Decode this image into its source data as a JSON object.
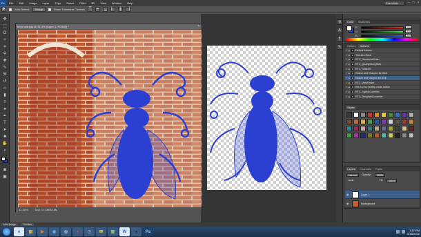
{
  "app": {
    "logo": "Ps",
    "menus": [
      "File",
      "Edit",
      "Image",
      "Layer",
      "Type",
      "Select",
      "Filter",
      "3D",
      "View",
      "Window",
      "Help"
    ],
    "workspace": "Essentials"
  },
  "options": {
    "auto_select_label": "Auto-Select:",
    "auto_select_value": "Group",
    "transform_label": "Show Transform Controls"
  },
  "documents": {
    "doc1": {
      "title": "brick wall.jpg @ 31.3% (Layer 1, RGB/8) *",
      "zoom": "31.33%",
      "doc_size": "Doc: 17.4M/34.8M"
    }
  },
  "panels": {
    "color": {
      "tabs": [
        "Color",
        "Swatches"
      ],
      "rows": [
        {
          "label": "R",
          "value": "255",
          "color": "#ff2a2a"
        },
        {
          "label": "G",
          "value": "255",
          "color": "#2aff2a"
        },
        {
          "label": "B",
          "value": "255",
          "color": "#2a6bff"
        }
      ]
    },
    "actions": {
      "tabs": [
        "History",
        "Actions"
      ],
      "items": [
        {
          "label": "Default Actions",
          "sel": false
        },
        {
          "label": "Textures Rock",
          "sel": false
        },
        {
          "label": "RTC_GoodnessGrain",
          "sel": false
        },
        {
          "label": "RTC_QualityGlow(Web",
          "sel": false
        },
        {
          "label": "RTC_Glitter01",
          "sel": false
        },
        {
          "label": "Resize and Sharpen for Web",
          "sel": false
        },
        {
          "label": "Resize and sharpen for web",
          "sel": true
        },
        {
          "label": "RTC_ViewFinder",
          "sel": false
        },
        {
          "label": "RB in One Quality Clean Action",
          "sel": false
        },
        {
          "label": "RTC_Stylin&ColorSet",
          "sel": false
        },
        {
          "label": "RTC_TemplateConverter",
          "sel": false
        },
        {
          "label": "Textures Rock",
          "sel": false
        },
        {
          "label": "Copyright (c) 2010 - Paint the Moon",
          "sel": false
        }
      ]
    },
    "styles": {
      "tabs": [
        "Styles"
      ],
      "swatches": [
        "#3a3a3a",
        "#ffffff",
        "#888888",
        "#cc3333",
        "#d98a2b",
        "#e6c84a",
        "#4a8a3a",
        "#3a6fc4",
        "#6a3aa4",
        "#b0b0b0",
        "#7a4a2a",
        "#c46a3a",
        "#d4b04a",
        "#4a9a4a",
        "#2a5aa4",
        "#8a3ab4",
        "#d4d4d4",
        "#5a5a5a",
        "#a43a3a",
        "#c48a3a",
        "#2a8aa4",
        "#9a2a5a",
        "#caa",
        "#3a7a7a",
        "#ba8",
        "#6a6a9a",
        "#a4a43a",
        "#444444",
        "#e0c090",
        "#5a2a2a",
        "#3aa43a",
        "#a43aa4",
        "#2a2a7a",
        "#7a7a2a",
        "#b45a2a",
        "#5ab4b4",
        "#cccc66",
        "#222222",
        "#8a8a8a",
        "#c0c0c0"
      ]
    },
    "layers": {
      "tabs": [
        "Layers",
        "Channels",
        "Paths"
      ],
      "blend_mode": "Normal",
      "opacity_label": "Opacity:",
      "opacity": "100%",
      "lock_label": "Lock:",
      "fill_label": "Fill:",
      "fill": "100%",
      "items": [
        {
          "name": "Layer 1",
          "thumb": "#ffffff"
        },
        {
          "name": "Background",
          "thumb": "#c0603a"
        }
      ]
    }
  },
  "bottom_tabs": [
    "Mini Bridge",
    "Timeline"
  ],
  "taskbar": {
    "apps": [
      {
        "label": "e",
        "color": "#2b7fd4",
        "bg": "#dfe9f5"
      },
      {
        "label": "▤",
        "color": "#f0c040",
        "bg": "#3a5a80"
      },
      {
        "label": "▶",
        "color": "#ff7a00",
        "bg": "#3a5a80"
      },
      {
        "label": "◉",
        "color": "#5ab4ff",
        "bg": "#3a5a80"
      },
      {
        "label": "◎",
        "color": "#d8d8d8",
        "bg": "#3a5a80"
      },
      {
        "label": "◕",
        "color": "#e84a3a",
        "bg": "#3a5a80"
      },
      {
        "label": "◷",
        "color": "#9a9a9a",
        "bg": "#3a5a80"
      },
      {
        "label": "✉",
        "color": "#ffdd33",
        "bg": "#3a5a80"
      },
      {
        "label": "▦",
        "color": "#8acd3a",
        "bg": "#3a5a80"
      },
      {
        "label": "W",
        "color": "#2b5fb5",
        "bg": "#dfe9f5"
      },
      {
        "label": "●",
        "color": "#2a2a2a",
        "bg": "#3a5a80"
      },
      {
        "label": "Ps",
        "color": "#9cd2ff",
        "bg": "#1d3f6a"
      }
    ],
    "time": "1:37 PM",
    "date": "6/18/2012"
  }
}
